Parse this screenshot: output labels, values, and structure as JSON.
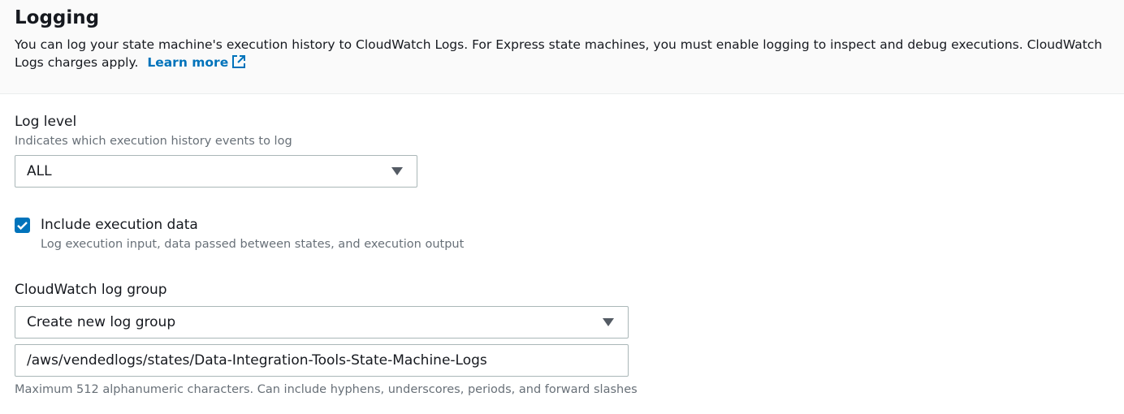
{
  "logging": {
    "title": "Logging",
    "description": "You can log your state machine's execution history to CloudWatch Logs. For Express state machines, you must enable logging to inspect and debug executions. CloudWatch Logs charges apply.",
    "learn_more": "Learn more",
    "learn_more_icon": "external-link-icon"
  },
  "log_level": {
    "label": "Log level",
    "description": "Indicates which execution history events to log",
    "selected": "ALL"
  },
  "include_execution_data": {
    "checked": true,
    "label": "Include execution data",
    "description": "Log execution input, data passed between states, and execution output"
  },
  "log_group": {
    "label": "CloudWatch log group",
    "selected": "Create new log group",
    "name_value": "/aws/vendedlogs/states/Data-Integration-Tools-State-Machine-Logs",
    "constraint": "Maximum 512 alphanumeric characters. Can include hyphens, underscores, periods, and forward slashes"
  },
  "colors": {
    "accent": "#0073bb",
    "header_bg": "#fafafa",
    "hint_text": "#687078"
  }
}
